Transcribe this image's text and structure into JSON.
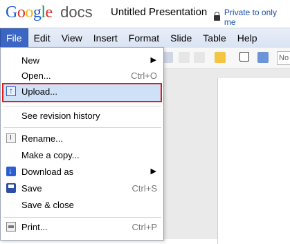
{
  "app": {
    "logo_google": "Google",
    "logo_docs": "docs",
    "document_title": "Untitled Presentation",
    "privacy_text": "Private to only me"
  },
  "menubar": {
    "items": [
      "File",
      "Edit",
      "View",
      "Insert",
      "Format",
      "Slide",
      "Table",
      "Help"
    ],
    "active_index": 0
  },
  "toolbar": {
    "font_field_text": "No"
  },
  "file_menu": {
    "items": [
      {
        "label": "New",
        "shortcut": "",
        "submenu": true,
        "icon": ""
      },
      {
        "label": "Open...",
        "shortcut": "Ctrl+O",
        "submenu": false,
        "icon": ""
      },
      {
        "label": "Upload...",
        "shortcut": "",
        "submenu": false,
        "icon": "upload-icon",
        "highlighted": true
      },
      {
        "label": "See revision history",
        "shortcut": "",
        "submenu": false,
        "icon": ""
      },
      {
        "label": "Rename...",
        "shortcut": "",
        "submenu": false,
        "icon": "rename-icon"
      },
      {
        "label": "Make a copy...",
        "shortcut": "",
        "submenu": false,
        "icon": ""
      },
      {
        "label": "Download as",
        "shortcut": "",
        "submenu": true,
        "icon": "download-icon"
      },
      {
        "label": "Save",
        "shortcut": "Ctrl+S",
        "submenu": false,
        "icon": "save-icon"
      },
      {
        "label": "Save & close",
        "shortcut": "",
        "submenu": false,
        "icon": ""
      },
      {
        "label": "Print...",
        "shortcut": "Ctrl+P",
        "submenu": false,
        "icon": "print-icon"
      }
    ]
  },
  "colors": {
    "menubar_active": "#3b66c4",
    "highlight_border": "#e21b1b",
    "highlight_fill": "#cfe1f7",
    "privacy_link": "#1a4fb3"
  }
}
